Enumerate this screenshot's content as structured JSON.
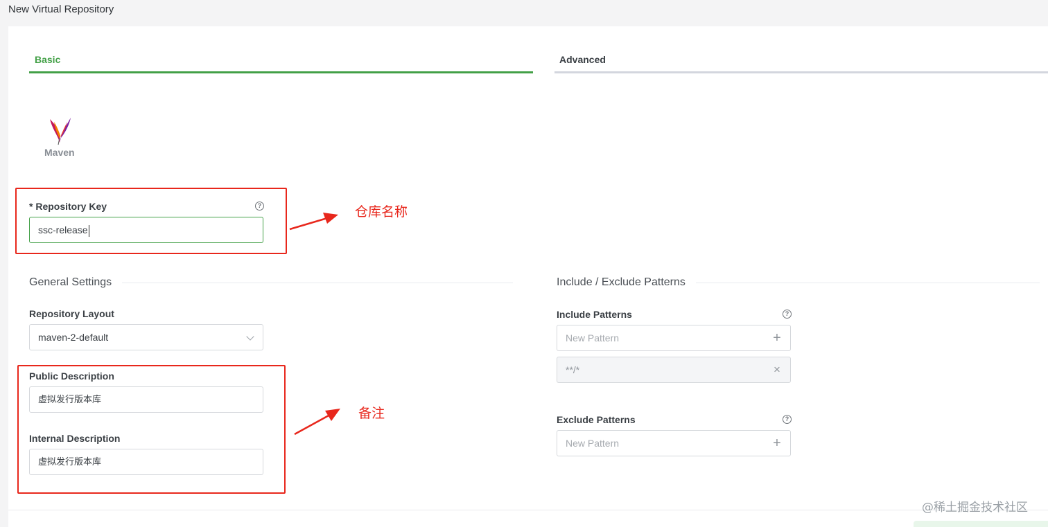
{
  "page": {
    "title": "New Virtual Repository"
  },
  "tabs": [
    {
      "label": "Basic",
      "active": true
    },
    {
      "label": "Advanced",
      "active": false
    }
  ],
  "package_type": {
    "icon": "apache-feather-icon",
    "label": "Maven"
  },
  "repository_key": {
    "label": "* Repository Key",
    "value": "ssc-release",
    "help_icon": "help-circle-icon"
  },
  "general_settings": {
    "title": "General Settings",
    "layout": {
      "label": "Repository Layout",
      "value": "maven-2-default"
    },
    "public_description": {
      "label": "Public Description",
      "value": "虚拟发行版本库"
    },
    "internal_description": {
      "label": "Internal Description",
      "value": "虚拟发行版本库"
    }
  },
  "patterns": {
    "title": "Include / Exclude Patterns",
    "include": {
      "label": "Include Patterns",
      "placeholder": "New Pattern",
      "items": [
        "**/*"
      ]
    },
    "exclude": {
      "label": "Exclude Patterns",
      "placeholder": "New Pattern"
    }
  },
  "annotations": {
    "key_note": "仓库名称",
    "desc_note": "备注"
  },
  "watermark": "@稀土掘金技术社区",
  "colors": {
    "accent": "#43a047",
    "annotation": "#e8271c"
  }
}
